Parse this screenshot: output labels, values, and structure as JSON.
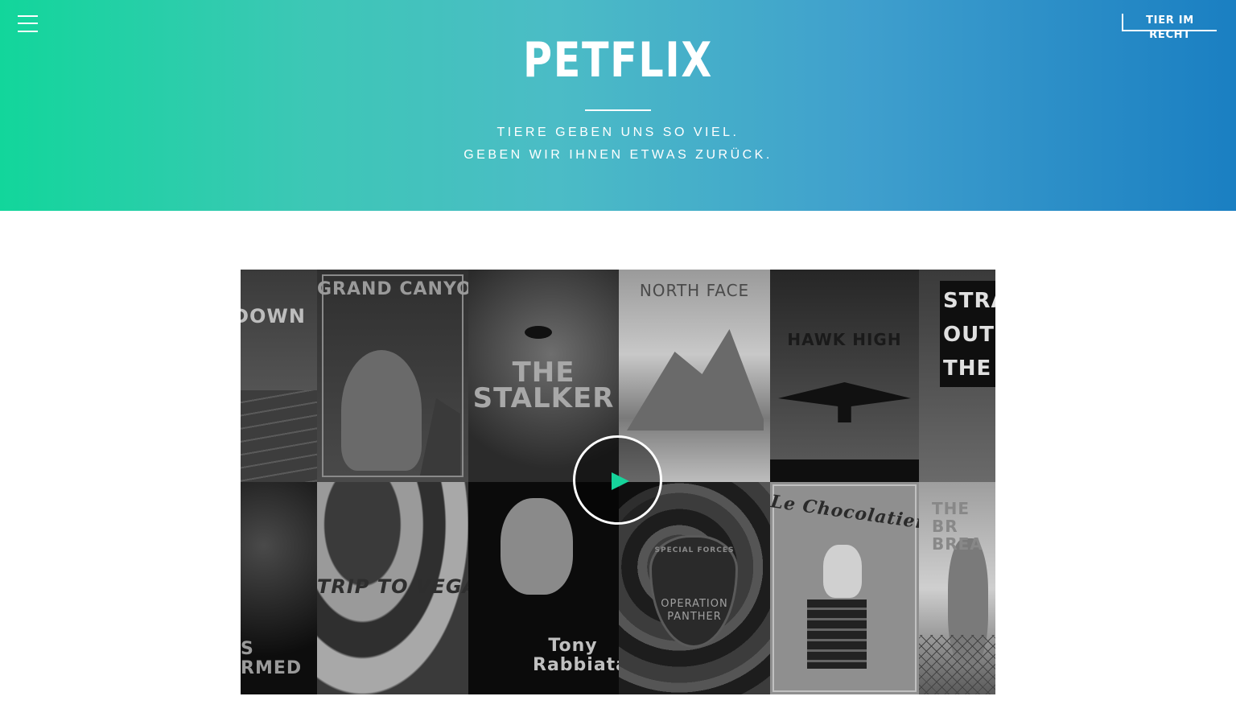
{
  "header": {
    "menu_icon": "hamburger-menu-icon",
    "corner_link": "TIER IM RECHT",
    "logo": "PETFLIX",
    "tagline_line1": "TIERE GEBEN UNS SO VIEL.",
    "tagline_line2": "GEBEN WIR IHNEN ETWAS ZURÜCK."
  },
  "colors": {
    "gradient_start": "#12d69b",
    "gradient_end": "#1a7fc2",
    "play_accent": "#16d49b"
  },
  "video": {
    "play_icon": "play-icon",
    "posters": [
      {
        "title": "DOWN"
      },
      {
        "title": "GRAND CANYON"
      },
      {
        "title": "THE STALKER"
      },
      {
        "title": "NORTH FACE"
      },
      {
        "title": "HAWK HIGH"
      },
      {
        "title": "STRA OUT THE"
      },
      {
        "title": "S RMED"
      },
      {
        "title": "TRIP TO VEGAS"
      },
      {
        "title": "Tony Rabbiata"
      },
      {
        "title": "OPERATION PANTHER",
        "subtitle": "SPECIAL FORCES"
      },
      {
        "title": "Le Chocolatier"
      },
      {
        "title": "THE BR BREA"
      }
    ]
  }
}
